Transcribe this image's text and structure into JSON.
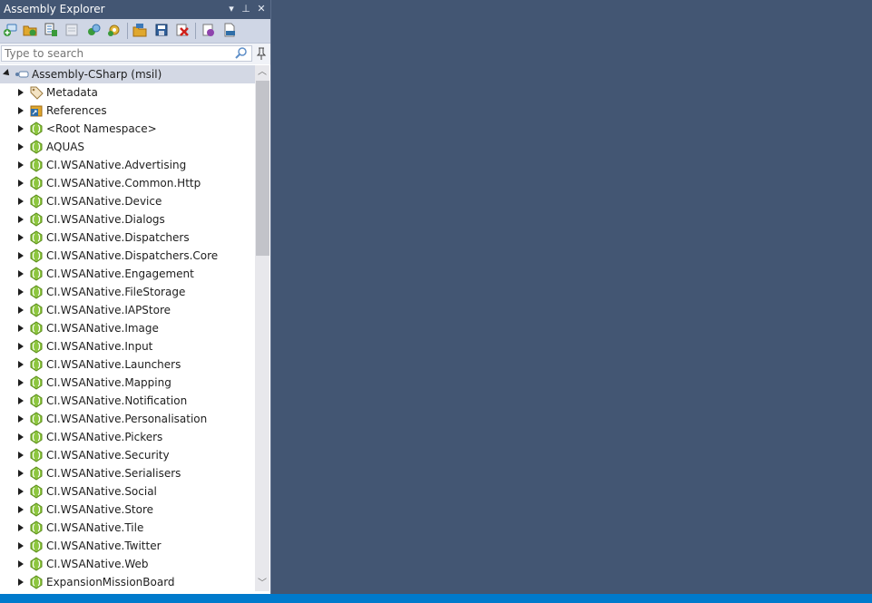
{
  "panel": {
    "title": "Assembly Explorer",
    "buttons": {
      "dropdown": "▾",
      "pin": "⊥",
      "close": "✕"
    }
  },
  "toolbar": {
    "icons": [
      "open-from-gac-icon",
      "open-folder-icon",
      "open-list-icon",
      "assembly-list-icon",
      "find-assembly-icon",
      "settings-search-icon",
      "export-project-icon",
      "save-list-icon",
      "remove-icon",
      "decompile-icon",
      "pdb-icon"
    ]
  },
  "search": {
    "placeholder": "Type to search"
  },
  "tree": {
    "root": {
      "label": "Assembly-CSharp (msil)",
      "icon": "assembly-icon",
      "expanded": true
    },
    "items": [
      {
        "label": "Metadata",
        "icon": "metadata-tag-icon"
      },
      {
        "label": "References",
        "icon": "references-icon"
      },
      {
        "label": "<Root Namespace>",
        "icon": "namespace-icon"
      },
      {
        "label": "AQUAS",
        "icon": "namespace-icon"
      },
      {
        "label": "CI.WSANative.Advertising",
        "icon": "namespace-icon"
      },
      {
        "label": "CI.WSANative.Common.Http",
        "icon": "namespace-icon"
      },
      {
        "label": "CI.WSANative.Device",
        "icon": "namespace-icon"
      },
      {
        "label": "CI.WSANative.Dialogs",
        "icon": "namespace-icon"
      },
      {
        "label": "CI.WSANative.Dispatchers",
        "icon": "namespace-icon"
      },
      {
        "label": "CI.WSANative.Dispatchers.Core",
        "icon": "namespace-icon"
      },
      {
        "label": "CI.WSANative.Engagement",
        "icon": "namespace-icon"
      },
      {
        "label": "CI.WSANative.FileStorage",
        "icon": "namespace-icon"
      },
      {
        "label": "CI.WSANative.IAPStore",
        "icon": "namespace-icon"
      },
      {
        "label": "CI.WSANative.Image",
        "icon": "namespace-icon"
      },
      {
        "label": "CI.WSANative.Input",
        "icon": "namespace-icon"
      },
      {
        "label": "CI.WSANative.Launchers",
        "icon": "namespace-icon"
      },
      {
        "label": "CI.WSANative.Mapping",
        "icon": "namespace-icon"
      },
      {
        "label": "CI.WSANative.Notification",
        "icon": "namespace-icon"
      },
      {
        "label": "CI.WSANative.Personalisation",
        "icon": "namespace-icon"
      },
      {
        "label": "CI.WSANative.Pickers",
        "icon": "namespace-icon"
      },
      {
        "label": "CI.WSANative.Security",
        "icon": "namespace-icon"
      },
      {
        "label": "CI.WSANative.Serialisers",
        "icon": "namespace-icon"
      },
      {
        "label": "CI.WSANative.Social",
        "icon": "namespace-icon"
      },
      {
        "label": "CI.WSANative.Store",
        "icon": "namespace-icon"
      },
      {
        "label": "CI.WSANative.Tile",
        "icon": "namespace-icon"
      },
      {
        "label": "CI.WSANative.Twitter",
        "icon": "namespace-icon"
      },
      {
        "label": "CI.WSANative.Web",
        "icon": "namespace-icon"
      },
      {
        "label": "ExpansionMissionBoard",
        "icon": "namespace-icon"
      }
    ]
  },
  "colors": {
    "background": "#435673",
    "toolbar": "#cfd6e5",
    "selection": "#d3d8e4",
    "status_bar": "#007acc",
    "namespace_icon": "#8dc63f"
  }
}
